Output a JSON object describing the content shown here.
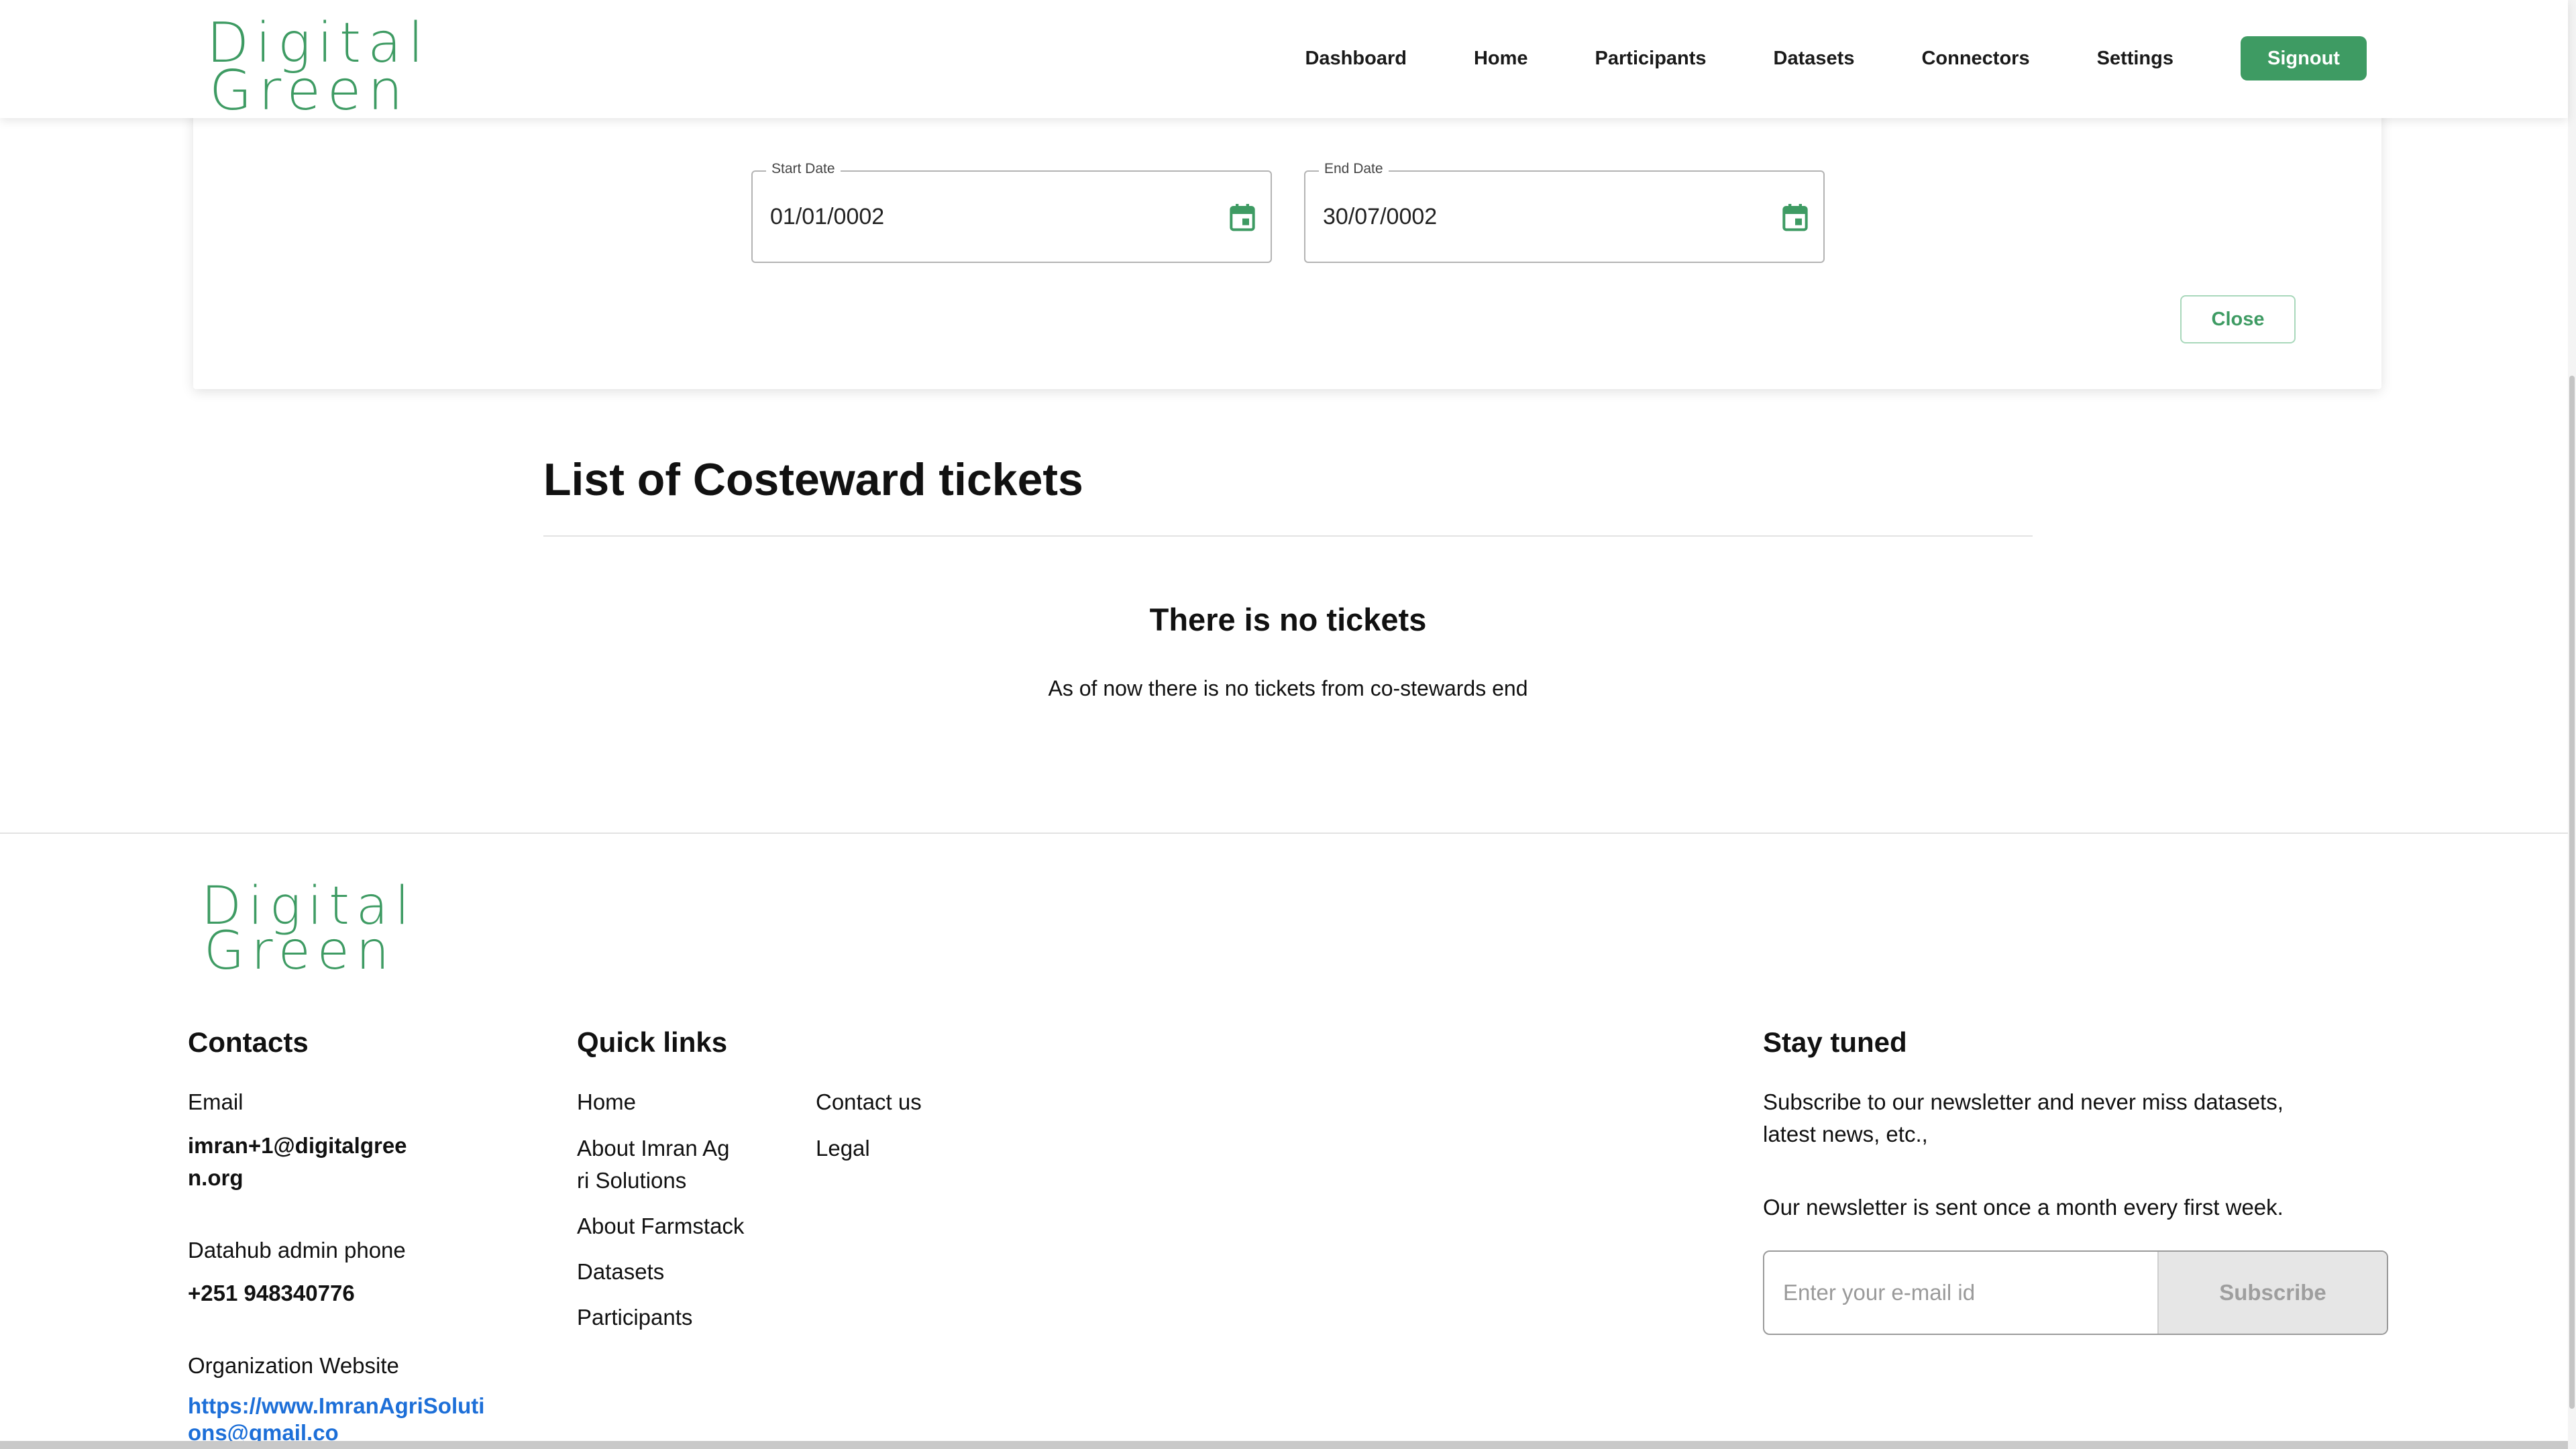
{
  "nav": {
    "logo_line1": "Digital",
    "logo_line2": "Green",
    "links": [
      "Dashboard",
      "Home",
      "Participants",
      "Datasets",
      "Connectors",
      "Settings"
    ],
    "signout_label": "Signout",
    "brand_color": "#3e9b63"
  },
  "filter": {
    "start_label": "Start Date",
    "start_value": "01/01/0002",
    "end_label": "End Date",
    "end_value": "30/07/0002",
    "calendar_icon": "calendar-icon",
    "close_label": "Close"
  },
  "main": {
    "title": "List of Costeward tickets",
    "empty_heading": "There is no tickets",
    "empty_text": "As of now there is no tickets from co-stewards end"
  },
  "footer": {
    "logo_line1": "Digital",
    "logo_line2": "Green",
    "contacts": {
      "heading": "Contacts",
      "email_label": "Email",
      "email_line1": "imran+1@digitalgree",
      "email_line2": "n.org",
      "phone_label": "Datahub admin phone",
      "phone_value": "+251 948340776",
      "website_label": "Organization Website",
      "website_line1": "https://www.ImranAgriSoluti",
      "website_line2": "ons@gmail.co"
    },
    "quick_links": {
      "heading": "Quick links",
      "col1": [
        "Home",
        "About Imran Ag",
        "ri Solutions",
        "About Farmstack",
        "Datasets",
        "Participants"
      ],
      "col2": [
        "Contact us",
        "Legal"
      ]
    },
    "stay_tuned": {
      "heading": "Stay tuned",
      "line1": "Subscribe to our newsletter and never miss datasets,",
      "line2": "latest news, etc.,",
      "line3": "Our newsletter is sent once a month every first week.",
      "email_placeholder": "Enter your e-mail id",
      "subscribe_label": "Subscribe"
    }
  }
}
